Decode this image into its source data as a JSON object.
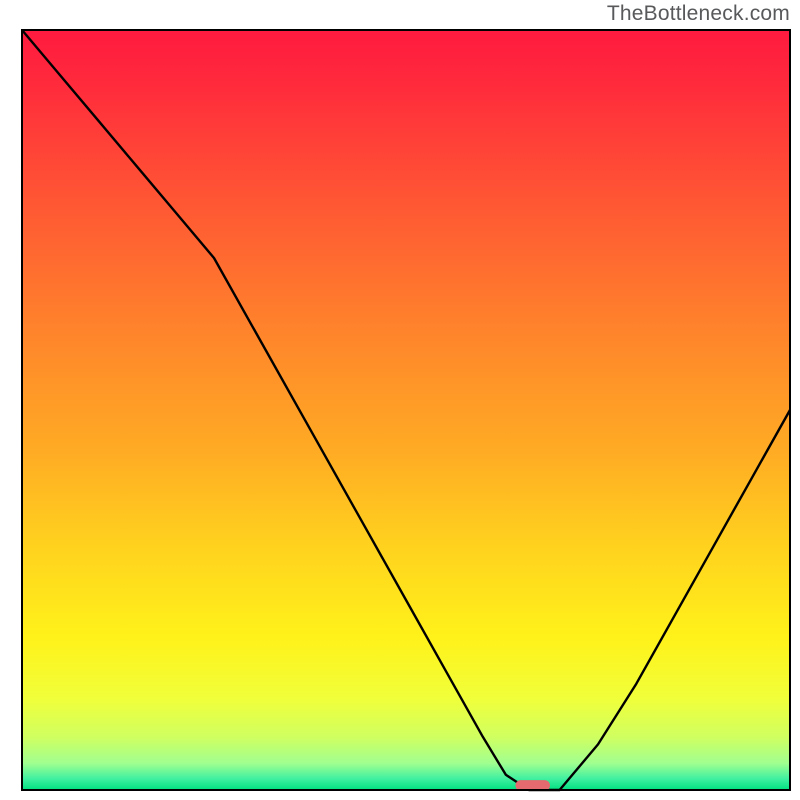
{
  "watermark": "TheBottleneck.com",
  "chart_data": {
    "type": "line",
    "title": "",
    "xlabel": "",
    "ylabel": "",
    "xlim": [
      0,
      100
    ],
    "ylim": [
      0,
      100
    ],
    "x": [
      0,
      5,
      10,
      15,
      20,
      25,
      30,
      35,
      40,
      45,
      50,
      55,
      60,
      63,
      66,
      70,
      75,
      80,
      85,
      90,
      95,
      100
    ],
    "y": [
      100,
      94,
      88,
      82,
      76,
      70,
      61,
      52,
      43,
      34,
      25,
      16,
      7,
      2,
      0,
      0,
      6,
      14,
      23,
      32,
      41,
      50
    ],
    "gradient_stops": [
      {
        "pos": 0.0,
        "color": "#ff1a3f"
      },
      {
        "pos": 0.07,
        "color": "#ff2a3c"
      },
      {
        "pos": 0.18,
        "color": "#ff4a36"
      },
      {
        "pos": 0.3,
        "color": "#ff6a30"
      },
      {
        "pos": 0.42,
        "color": "#ff8a2a"
      },
      {
        "pos": 0.55,
        "color": "#ffaa24"
      },
      {
        "pos": 0.68,
        "color": "#ffd21e"
      },
      {
        "pos": 0.8,
        "color": "#fff21a"
      },
      {
        "pos": 0.88,
        "color": "#f0ff3a"
      },
      {
        "pos": 0.93,
        "color": "#d0ff60"
      },
      {
        "pos": 0.965,
        "color": "#a0ff90"
      },
      {
        "pos": 0.985,
        "color": "#40f0a0"
      },
      {
        "pos": 1.0,
        "color": "#00e080"
      }
    ],
    "marker": {
      "x_frac": 0.665,
      "y_frac": 0.994,
      "w_frac": 0.045,
      "h_frac": 0.014,
      "color": "#e46a6f"
    },
    "frame_color": "#000000",
    "frame_width": 2,
    "curve_color": "#000000",
    "curve_width": 2.4
  }
}
